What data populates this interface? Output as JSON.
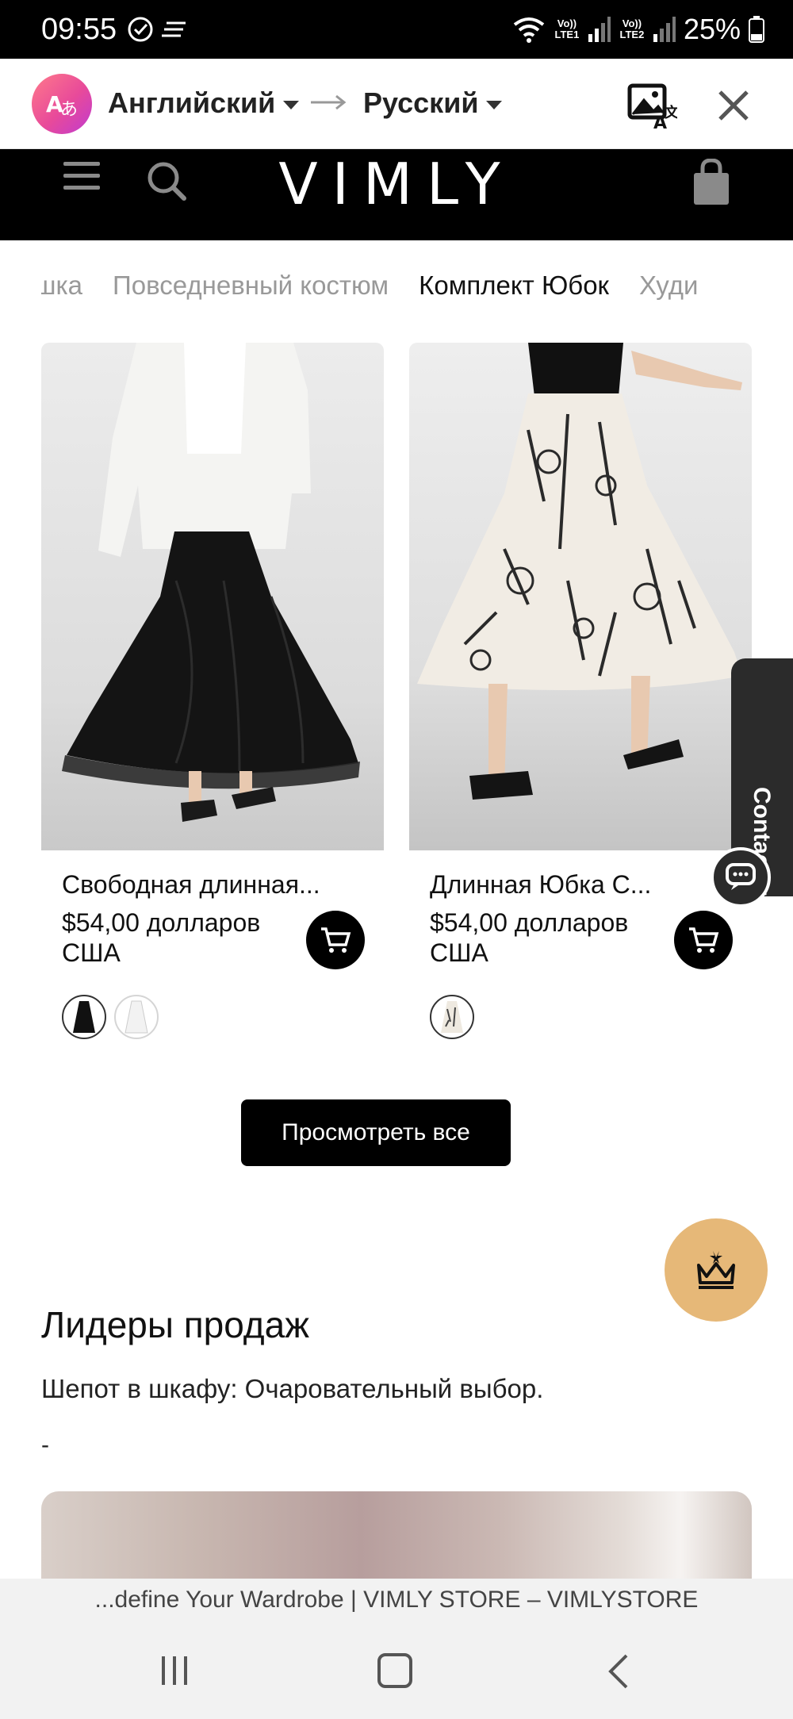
{
  "status_bar": {
    "time": "09:55",
    "battery_text": "25%",
    "sim1_label": "Vo)) LTE1",
    "sim2_label": "Vo)) LTE2"
  },
  "translate_bar": {
    "source_language": "Английский",
    "target_language": "Русский"
  },
  "site_header": {
    "logo": "VIMLY"
  },
  "categories": [
    "шка",
    "Повседневный костюм",
    "Комплект Юбок",
    "Худи"
  ],
  "products": [
    {
      "title": "Свободная длинная...",
      "price": "$54,00 долларов США",
      "swatches": [
        "black",
        "white"
      ]
    },
    {
      "title": "Длинная Юбка С...",
      "price": "$54,00 долларов США",
      "swatches": [
        "floral-print"
      ]
    }
  ],
  "contact_tab": {
    "label": "Contact us"
  },
  "view_all_label": "Просмотреть все",
  "bestsellers": {
    "title": "Лидеры продаж",
    "subtitle": "Шепот в шкафу: Очаровательный выбор.",
    "dash": "-"
  },
  "browser": {
    "page_title": "...define Your Wardrobe | VIMLY STORE – VIMLYSTORE"
  },
  "colors": {
    "accent_gold": "#e6b878",
    "header_bg": "#000000",
    "contact_bg": "#2b2b2b"
  },
  "icons": [
    "check-circle-icon",
    "notification-lines-icon",
    "wifi-icon",
    "signal-icon",
    "battery-icon",
    "translate-logo-icon",
    "arrow-right-icon",
    "image-translate-icon",
    "close-icon",
    "hamburger-icon",
    "search-icon",
    "shopping-bag-icon",
    "cart-icon",
    "chat-icon",
    "crown-icon"
  ]
}
